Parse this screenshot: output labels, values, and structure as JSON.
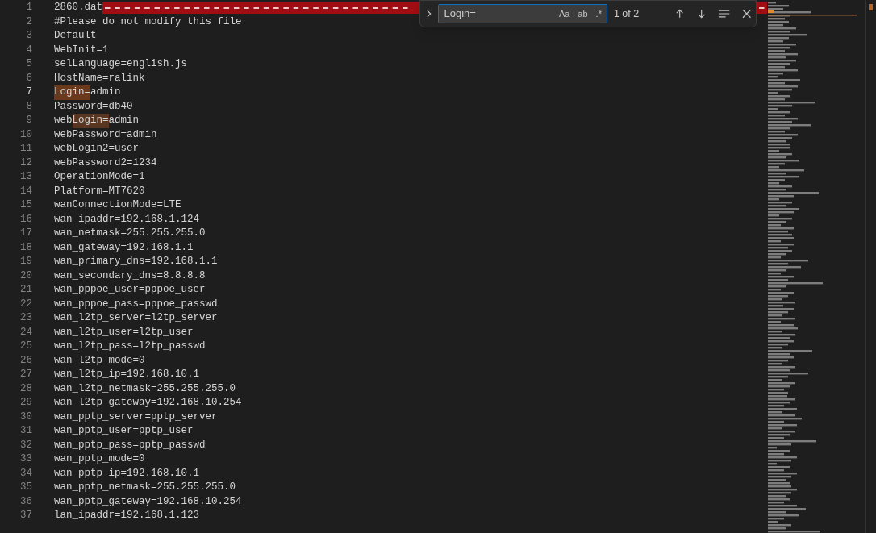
{
  "editor": {
    "lines": [
      {
        "number": "1",
        "active": false,
        "nul_marks": true,
        "segments": [
          {
            "text": "2860.dat",
            "kind": "text"
          }
        ]
      },
      {
        "number": "2",
        "active": false,
        "segments": [
          {
            "text": "#Please do not modify this file",
            "kind": "text"
          }
        ]
      },
      {
        "number": "3",
        "active": false,
        "segments": [
          {
            "text": "Default",
            "kind": "text"
          }
        ]
      },
      {
        "number": "4",
        "active": false,
        "segments": [
          {
            "text": "WebInit=1",
            "kind": "text"
          }
        ]
      },
      {
        "number": "5",
        "active": false,
        "segments": [
          {
            "text": "selLanguage=english.js",
            "kind": "text"
          }
        ]
      },
      {
        "number": "6",
        "active": false,
        "segments": [
          {
            "text": "HostName=ralink",
            "kind": "text"
          }
        ]
      },
      {
        "number": "7",
        "active": true,
        "segments": [
          {
            "text": "Login=",
            "kind": "current_match"
          },
          {
            "text": "admin",
            "kind": "text"
          }
        ]
      },
      {
        "number": "8",
        "active": false,
        "segments": [
          {
            "text": "Password=db40",
            "kind": "text"
          }
        ]
      },
      {
        "number": "9",
        "active": false,
        "segments": [
          {
            "text": "web",
            "kind": "text"
          },
          {
            "text": "Login=",
            "kind": "match"
          },
          {
            "text": "admin",
            "kind": "text"
          }
        ]
      },
      {
        "number": "10",
        "active": false,
        "segments": [
          {
            "text": "webPassword=admin",
            "kind": "text"
          }
        ]
      },
      {
        "number": "11",
        "active": false,
        "segments": [
          {
            "text": "webLogin2=user",
            "kind": "text"
          }
        ]
      },
      {
        "number": "12",
        "active": false,
        "segments": [
          {
            "text": "webPassword2=1234",
            "kind": "text"
          }
        ]
      },
      {
        "number": "13",
        "active": false,
        "segments": [
          {
            "text": "OperationMode=1",
            "kind": "text"
          }
        ]
      },
      {
        "number": "14",
        "active": false,
        "segments": [
          {
            "text": "Platform=MT7620",
            "kind": "text"
          }
        ]
      },
      {
        "number": "15",
        "active": false,
        "segments": [
          {
            "text": "wanConnectionMode=LTE",
            "kind": "text"
          }
        ]
      },
      {
        "number": "16",
        "active": false,
        "segments": [
          {
            "text": "wan_ipaddr=192.168.1.124",
            "kind": "text"
          }
        ]
      },
      {
        "number": "17",
        "active": false,
        "segments": [
          {
            "text": "wan_netmask=255.255.255.0",
            "kind": "text"
          }
        ]
      },
      {
        "number": "18",
        "active": false,
        "segments": [
          {
            "text": "wan_gateway=192.168.1.1",
            "kind": "text"
          }
        ]
      },
      {
        "number": "19",
        "active": false,
        "segments": [
          {
            "text": "wan_primary_dns=192.168.1.1",
            "kind": "text"
          }
        ]
      },
      {
        "number": "20",
        "active": false,
        "segments": [
          {
            "text": "wan_secondary_dns=8.8.8.8",
            "kind": "text"
          }
        ]
      },
      {
        "number": "21",
        "active": false,
        "segments": [
          {
            "text": "wan_pppoe_user=pppoe_user",
            "kind": "text"
          }
        ]
      },
      {
        "number": "22",
        "active": false,
        "segments": [
          {
            "text": "wan_pppoe_pass=pppoe_passwd",
            "kind": "text"
          }
        ]
      },
      {
        "number": "23",
        "active": false,
        "segments": [
          {
            "text": "wan_l2tp_server=l2tp_server",
            "kind": "text"
          }
        ]
      },
      {
        "number": "24",
        "active": false,
        "segments": [
          {
            "text": "wan_l2tp_user=l2tp_user",
            "kind": "text"
          }
        ]
      },
      {
        "number": "25",
        "active": false,
        "segments": [
          {
            "text": "wan_l2tp_pass=l2tp_passwd",
            "kind": "text"
          }
        ]
      },
      {
        "number": "26",
        "active": false,
        "segments": [
          {
            "text": "wan_l2tp_mode=0",
            "kind": "text"
          }
        ]
      },
      {
        "number": "27",
        "active": false,
        "segments": [
          {
            "text": "wan_l2tp_ip=192.168.10.1",
            "kind": "text"
          }
        ]
      },
      {
        "number": "28",
        "active": false,
        "segments": [
          {
            "text": "wan_l2tp_netmask=255.255.255.0",
            "kind": "text"
          }
        ]
      },
      {
        "number": "29",
        "active": false,
        "segments": [
          {
            "text": "wan_l2tp_gateway=192.168.10.254",
            "kind": "text"
          }
        ]
      },
      {
        "number": "30",
        "active": false,
        "segments": [
          {
            "text": "wan_pptp_server=pptp_server",
            "kind": "text"
          }
        ]
      },
      {
        "number": "31",
        "active": false,
        "segments": [
          {
            "text": "wan_pptp_user=pptp_user",
            "kind": "text"
          }
        ]
      },
      {
        "number": "32",
        "active": false,
        "segments": [
          {
            "text": "wan_pptp_pass=pptp_passwd",
            "kind": "text"
          }
        ]
      },
      {
        "number": "33",
        "active": false,
        "segments": [
          {
            "text": "wan_pptp_mode=0",
            "kind": "text"
          }
        ]
      },
      {
        "number": "34",
        "active": false,
        "segments": [
          {
            "text": "wan_pptp_ip=192.168.10.1",
            "kind": "text"
          }
        ]
      },
      {
        "number": "35",
        "active": false,
        "segments": [
          {
            "text": "wan_pptp_netmask=255.255.255.0",
            "kind": "text"
          }
        ]
      },
      {
        "number": "36",
        "active": false,
        "segments": [
          {
            "text": "wan_pptp_gateway=192.168.10.254",
            "kind": "text"
          }
        ]
      },
      {
        "number": "37",
        "active": false,
        "segments": [
          {
            "text": "lan_ipaddr=192.168.1.123",
            "kind": "text"
          }
        ]
      }
    ]
  },
  "find_widget": {
    "query": "Login=",
    "options": [
      {
        "label": "Aa",
        "on": false
      },
      {
        "label": "ab",
        "on": false
      },
      {
        "label": ".*",
        "on": false
      }
    ],
    "count": "1 of 2"
  }
}
